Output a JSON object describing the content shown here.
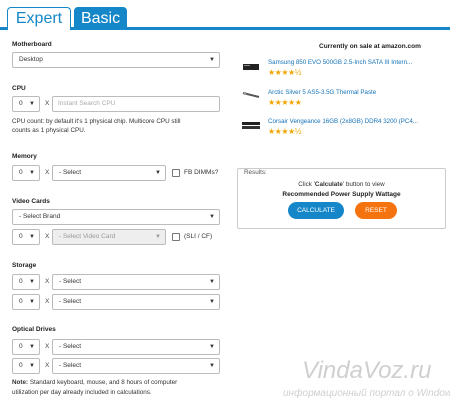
{
  "tabs": {
    "expert": "Expert",
    "basic": "Basic"
  },
  "motherboard": {
    "label": "Motherboard",
    "value": "Desktop"
  },
  "cpu": {
    "label": "CPU",
    "qty": "0",
    "x": "X",
    "placeholder": "Instant Search CPU",
    "note1": "CPU count: by default it's 1 physical chip. Multicore CPU still",
    "note2": "counts as 1 physical CPU."
  },
  "memory": {
    "label": "Memory",
    "qty": "0",
    "x": "X",
    "value": "- Select",
    "checkbox_label": "FB DIMMs?"
  },
  "video": {
    "label": "Video Cards",
    "brand": "- Select Brand",
    "qty": "0",
    "x": "X",
    "card": "- Select Video Card",
    "checkbox_label": "(SLI / CF)"
  },
  "storage": {
    "label": "Storage",
    "rows": [
      {
        "qty": "0",
        "x": "X",
        "value": "- Select"
      },
      {
        "qty": "0",
        "x": "X",
        "value": "- Select"
      }
    ]
  },
  "optical": {
    "label": "Optical Drives",
    "rows": [
      {
        "qty": "0",
        "x": "X",
        "value": "- Select"
      },
      {
        "qty": "0",
        "x": "X",
        "value": "- Select"
      }
    ]
  },
  "note": {
    "bold": "Note:",
    "line1": " Standard keyboard, mouse, and 8 hours of computer",
    "line2": "utilization per day already included in calculations."
  },
  "sale": {
    "title": "Currently on sale at amazon.com",
    "products": [
      {
        "name": "Samsung 850 EVO 500GB 2.5-Inch SATA III Intern...",
        "stars": "★★★★½"
      },
      {
        "name": "Arctic Silver 5 AS5-3.5G Thermal Paste",
        "stars": "★★★★★"
      },
      {
        "name": "Corsair Vengeance 16GB (2x8GB) DDR4 3200 (PC4...",
        "stars": "★★★★½"
      }
    ]
  },
  "results": {
    "title": "Results:",
    "line1_pre": "Click '",
    "line1_bold": "Calculate",
    "line1_post": "' button to view",
    "line2": "Recommended Power Supply Wattage",
    "calculate": "CALCULATE",
    "reset": "RESET"
  },
  "watermark": {
    "big": "VindaVoz.ru",
    "small": "информационный портал о Windows"
  },
  "colors": {
    "accent": "#1587c9",
    "reset": "#f5730e",
    "star": "#f0a500"
  }
}
